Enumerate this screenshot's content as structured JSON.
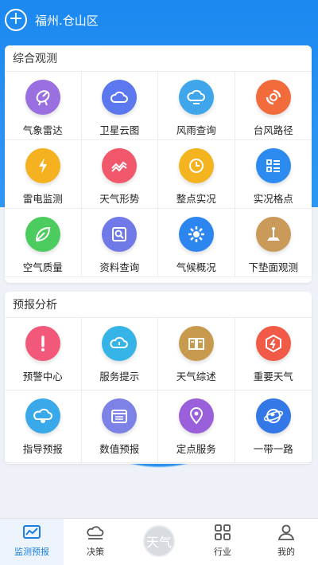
{
  "header": {
    "location": "福州.仓山区"
  },
  "section1": {
    "title": "综合观测",
    "items": [
      {
        "label": "气象雷达",
        "icon": "radar-dish-icon",
        "color": "#9a6fe0"
      },
      {
        "label": "卫星云图",
        "icon": "cloud-icon",
        "color": "#5b78ee"
      },
      {
        "label": "风雨查询",
        "icon": "wind-rain-icon",
        "color": "#3fa6ec"
      },
      {
        "label": "台风路径",
        "icon": "typhoon-icon",
        "color": "#f26b3a"
      },
      {
        "label": "雷电监测",
        "icon": "lightning-icon",
        "color": "#f5b11f"
      },
      {
        "label": "天气形势",
        "icon": "trend-chart-icon",
        "color": "#f2586b"
      },
      {
        "label": "整点实况",
        "icon": "clock-icon",
        "color": "#f3b41f"
      },
      {
        "label": "实况格点",
        "icon": "grid-list-icon",
        "color": "#2d8bef"
      },
      {
        "label": "空气质量",
        "icon": "leaf-icon",
        "color": "#4ccb5e"
      },
      {
        "label": "资料查询",
        "icon": "document-search-icon",
        "color": "#6f79e8"
      },
      {
        "label": "气候概况",
        "icon": "sun-gear-icon",
        "color": "#2d86ef"
      },
      {
        "label": "下垫面观测",
        "icon": "surface-station-icon",
        "color": "#c99a5a"
      }
    ]
  },
  "section2": {
    "title": "预报分析",
    "items": [
      {
        "label": "预警中心",
        "icon": "alert-exclamation-icon",
        "color": "#f2587a"
      },
      {
        "label": "服务提示",
        "icon": "cloud-alert-icon",
        "color": "#36b4e8"
      },
      {
        "label": "天气综述",
        "icon": "book-icon",
        "color": "#c79a4e"
      },
      {
        "label": "重要天气",
        "icon": "warning-hexagon-icon",
        "color": "#f25a48"
      },
      {
        "label": "指导预报",
        "icon": "cloud-clock-icon",
        "color": "#39a9ea"
      },
      {
        "label": "数值预报",
        "icon": "calendar-number-icon",
        "color": "#7c82e6"
      },
      {
        "label": "定点服务",
        "icon": "location-pin-icon",
        "color": "#9a5fdb"
      },
      {
        "label": "一带一路",
        "icon": "globe-icon",
        "color": "#3378e6"
      }
    ]
  },
  "nav": {
    "items": [
      {
        "label": "监测预报",
        "icon": "chart-monitor-icon",
        "active": true
      },
      {
        "label": "决策",
        "icon": "cloud-hat-icon",
        "active": false
      },
      {
        "label": "天气",
        "icon": "weather-center-icon",
        "active": false
      },
      {
        "label": "行业",
        "icon": "apps-grid-icon",
        "active": false
      },
      {
        "label": "我的",
        "icon": "user-icon",
        "active": false
      }
    ]
  }
}
